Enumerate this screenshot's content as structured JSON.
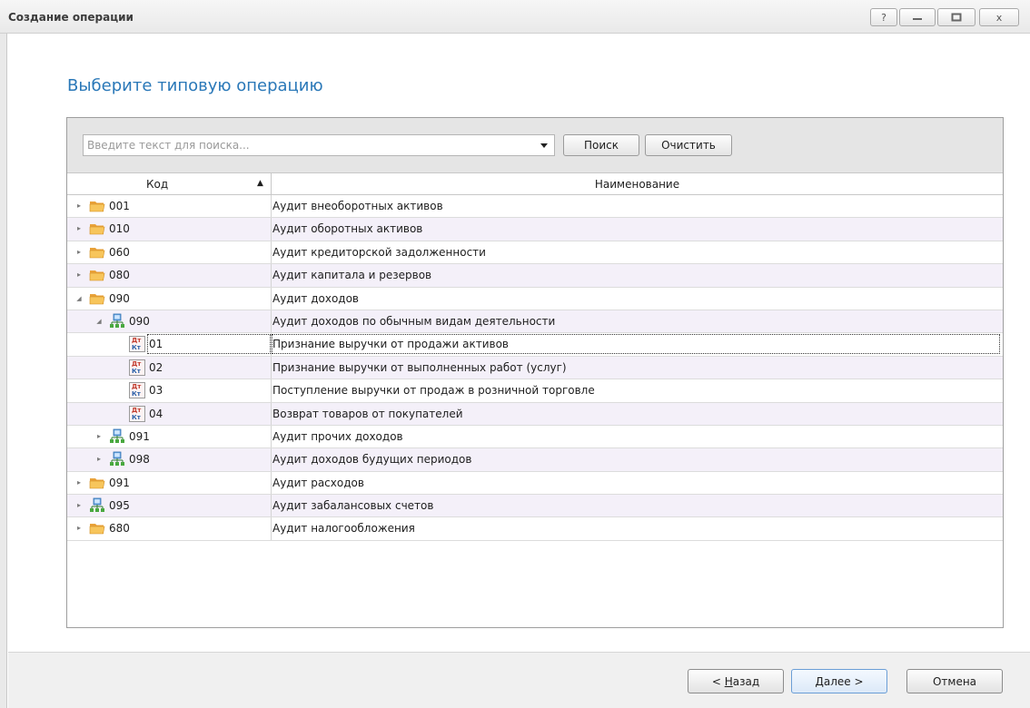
{
  "window": {
    "title": "Создание операции",
    "controls": {
      "help": "?",
      "minimize": "_",
      "maximize": "□",
      "close": "x"
    }
  },
  "heading": "Выберите типовую операцию",
  "search": {
    "placeholder": "Введите текст для поиска...",
    "search_button": "Поиск",
    "clear_button": "Очистить"
  },
  "columns": {
    "code": "Код",
    "name": "Наименование",
    "sort": "▲"
  },
  "rows": [
    {
      "level": 0,
      "expander": "collapsed",
      "icon": "folder",
      "code": "001",
      "name": "Аудит внеоборотных активов"
    },
    {
      "level": 0,
      "expander": "collapsed",
      "icon": "folder",
      "code": "010",
      "name": "Аудит оборотных активов"
    },
    {
      "level": 0,
      "expander": "collapsed",
      "icon": "folder",
      "code": "060",
      "name": "Аудит кредиторской задолженности"
    },
    {
      "level": 0,
      "expander": "collapsed",
      "icon": "folder",
      "code": "080",
      "name": "Аудит капитала и резервов"
    },
    {
      "level": 0,
      "expander": "expanded",
      "icon": "folder",
      "code": "090",
      "name": "Аудит доходов"
    },
    {
      "level": 1,
      "expander": "expanded",
      "icon": "group",
      "code": "090",
      "name": "Аудит доходов по обычным видам деятельности"
    },
    {
      "level": 2,
      "expander": "none",
      "icon": "operation",
      "code": "01",
      "name": "Признание выручки от продажи активов",
      "focused": true
    },
    {
      "level": 2,
      "expander": "none",
      "icon": "operation",
      "code": "02",
      "name": "Признание выручки от выполненных работ (услуг)"
    },
    {
      "level": 2,
      "expander": "none",
      "icon": "operation",
      "code": "03",
      "name": "Поступление выручки от продаж в розничной торговле"
    },
    {
      "level": 2,
      "expander": "none",
      "icon": "operation",
      "code": "04",
      "name": "Возврат товаров от покупателей"
    },
    {
      "level": 1,
      "expander": "collapsed",
      "icon": "group",
      "code": "091",
      "name": "Аудит прочих доходов"
    },
    {
      "level": 1,
      "expander": "collapsed",
      "icon": "group",
      "code": "098",
      "name": "Аудит доходов будущих периодов"
    },
    {
      "level": 0,
      "expander": "collapsed",
      "icon": "folder",
      "code": "091",
      "name": "Аудит расходов"
    },
    {
      "level": 0,
      "expander": "collapsed",
      "icon": "group",
      "code": "095",
      "name": "Аудит забалансовых счетов"
    },
    {
      "level": 0,
      "expander": "collapsed",
      "icon": "folder",
      "code": "680",
      "name": "Аудит налогообложения"
    }
  ],
  "icon_glyph": {
    "debit": "Дт",
    "credit": "Кт"
  },
  "footer": {
    "back_prefix": "< ",
    "back_key": "Н",
    "back_rest": "азад",
    "next_key": "Д",
    "next_rest": "алее >",
    "cancel": "Отмена"
  },
  "colors": {
    "accent": "#2a78b8",
    "row_alt": "#f4f0f9",
    "folder": "#f2b443",
    "group": "#3e9b3e"
  }
}
